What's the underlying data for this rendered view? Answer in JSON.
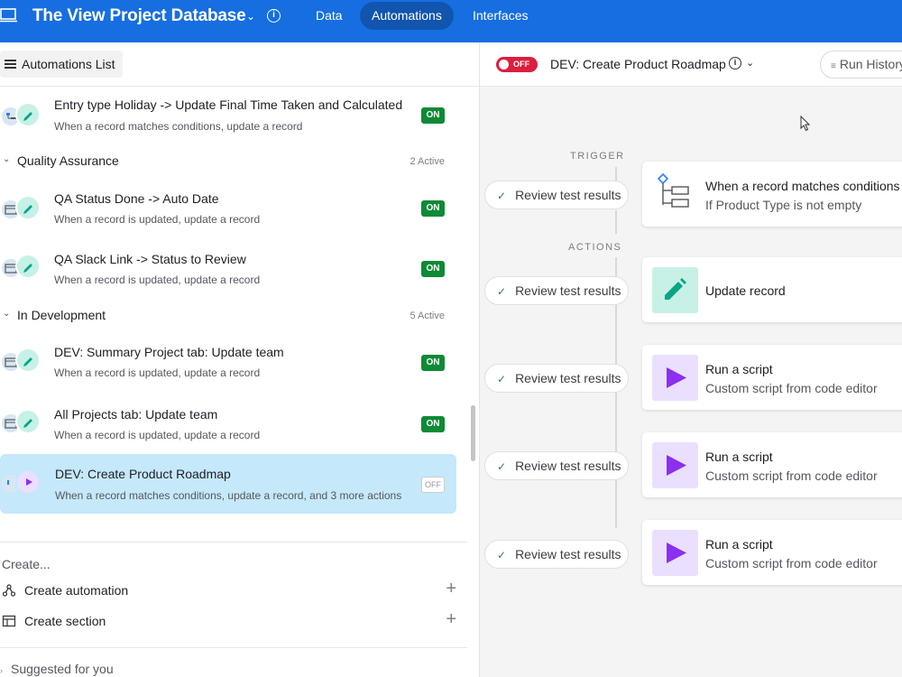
{
  "topbar": {
    "title": "The View Project Database",
    "nav": [
      "Data",
      "Automations",
      "Interfaces"
    ],
    "active_nav": "Automations",
    "color": "#166ee1"
  },
  "left": {
    "header_button": "Automations List",
    "items_top": [
      {
        "title": "Entry type Holiday -> Update Final Time Taken and Calculated",
        "subtitle": "When a record matches conditions, update a record",
        "status": "ON"
      }
    ],
    "sections": [
      {
        "name": "Quality Assurance",
        "count": "2 Active",
        "items": [
          {
            "title": "QA Status Done -> Auto Date",
            "subtitle": "When a record is updated, update a record",
            "status": "ON"
          },
          {
            "title": "QA Slack Link -> Status to Review",
            "subtitle": "When a record is updated, update a record",
            "status": "ON"
          }
        ]
      },
      {
        "name": "In Development",
        "count": "5 Active",
        "items": [
          {
            "title": "DEV: Summary Project tab: Update team",
            "subtitle": "When a record is updated, update a record",
            "status": "ON"
          },
          {
            "title": "All Projects tab: Update team",
            "subtitle": "When a record is updated, update a record",
            "status": "ON"
          },
          {
            "title": "DEV: Create Product Roadmap",
            "subtitle": "When a record matches conditions, update a record, and 3 more actions",
            "status": "OFF"
          }
        ]
      }
    ],
    "create": {
      "label": "Create...",
      "automation": "Create automation",
      "section": "Create section",
      "plus": "+"
    },
    "suggested": "Suggested for you"
  },
  "right": {
    "toggle": "OFF",
    "title": "DEV: Create Product Roadmap",
    "run_history": "Run History",
    "trigger_label": "TRIGGER",
    "actions_label": "ACTIONS",
    "review_label": "Review test results",
    "trigger_card": {
      "title": "When a record matches conditions",
      "subtitle": "If Product Type is not empty"
    },
    "action_cards": [
      {
        "title": "Update record",
        "subtitle": ""
      },
      {
        "title": "Run a script",
        "subtitle": "Custom script from code editor"
      },
      {
        "title": "Run a script",
        "subtitle": "Custom script from code editor"
      },
      {
        "title": "Run a script",
        "subtitle": "Custom script from code editor"
      }
    ],
    "colors": {
      "toggle_off": "#dc1f3c",
      "badge_on": "#0f8a36",
      "selected_row": "#c5e8fb",
      "script_icon": "#8b2ff0",
      "update_icon": "#0aa586"
    }
  }
}
